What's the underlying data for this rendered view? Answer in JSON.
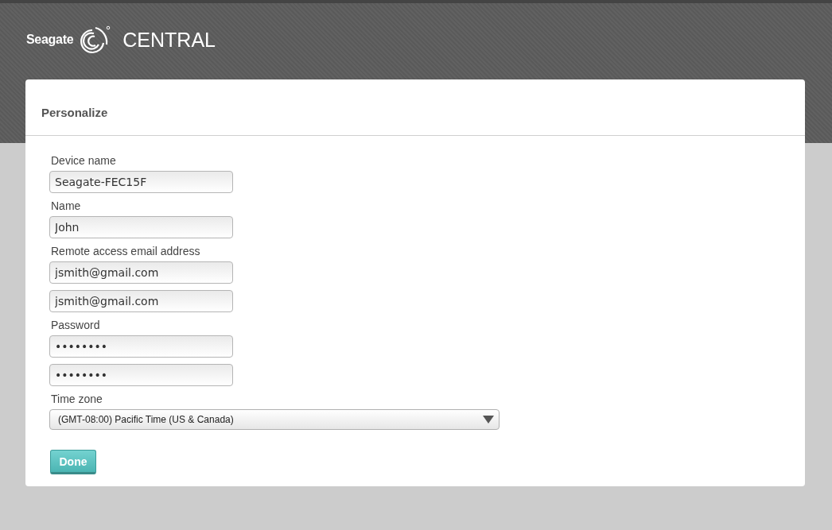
{
  "header": {
    "brand": "Seagate",
    "product": "CENTRAL"
  },
  "card": {
    "title": "Personalize"
  },
  "form": [
    {
      "kind": "label",
      "text": "Device name"
    },
    {
      "kind": "input",
      "value": "Seagate-FEC15F"
    },
    {
      "kind": "label",
      "text": "Name"
    },
    {
      "kind": "input",
      "value": "John"
    },
    {
      "kind": "label",
      "text": "Remote access email address"
    },
    {
      "kind": "input",
      "value": "jsmith@gmail.com"
    },
    {
      "kind": "input",
      "value": "jsmith@gmail.com"
    },
    {
      "kind": "label",
      "text": "Password"
    },
    {
      "kind": "input",
      "value": "••••••••"
    },
    {
      "kind": "input",
      "value": "••••••••"
    },
    {
      "kind": "label",
      "text": "Time zone"
    },
    {
      "kind": "select",
      "value": "(GMT-08:00) Pacific Time (US & Canada)"
    }
  ],
  "buttons": [
    "Done"
  ]
}
